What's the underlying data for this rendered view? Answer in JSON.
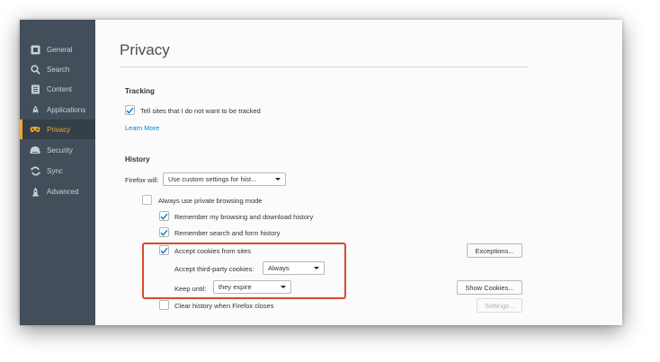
{
  "sidebar": {
    "items": [
      {
        "label": "General",
        "icon": "general-icon",
        "active": false
      },
      {
        "label": "Search",
        "icon": "search-icon",
        "active": false
      },
      {
        "label": "Content",
        "icon": "content-icon",
        "active": false
      },
      {
        "label": "Applications",
        "icon": "applications-icon",
        "active": false
      },
      {
        "label": "Privacy",
        "icon": "privacy-mask-icon",
        "active": true
      },
      {
        "label": "Security",
        "icon": "security-icon",
        "active": false
      },
      {
        "label": "Sync",
        "icon": "sync-icon",
        "active": false
      },
      {
        "label": "Advanced",
        "icon": "advanced-icon",
        "active": false
      }
    ]
  },
  "page": {
    "title": "Privacy"
  },
  "tracking": {
    "heading": "Tracking",
    "do_not_track_label": "Tell sites that I do not want to be tracked",
    "do_not_track_checked": true,
    "learn_more": "Learn More"
  },
  "history": {
    "heading": "History",
    "firefox_will_label": "Firefox will:",
    "firefox_will_value": "Use custom settings for hist...",
    "private_browsing_label": "Always use private browsing mode",
    "private_browsing_checked": false,
    "remember_browsing_label": "Remember my browsing and download history",
    "remember_browsing_checked": true,
    "remember_search_label": "Remember search and form history",
    "remember_search_checked": true,
    "accept_cookies_label": "Accept cookies from sites",
    "accept_cookies_checked": true,
    "exceptions_button": "Exceptions...",
    "third_party_label": "Accept third-party cookies:",
    "third_party_value": "Always",
    "keep_until_label": "Keep until:",
    "keep_until_value": "they expire",
    "show_cookies_button": "Show Cookies...",
    "clear_history_label": "Clear history when Firefox closes",
    "clear_history_checked": false,
    "settings_button": "Settings..."
  },
  "colors": {
    "sidebar_bg": "#424f5a",
    "accent": "#f0a830",
    "check": "#0a84d6",
    "highlight": "#d9472e"
  }
}
